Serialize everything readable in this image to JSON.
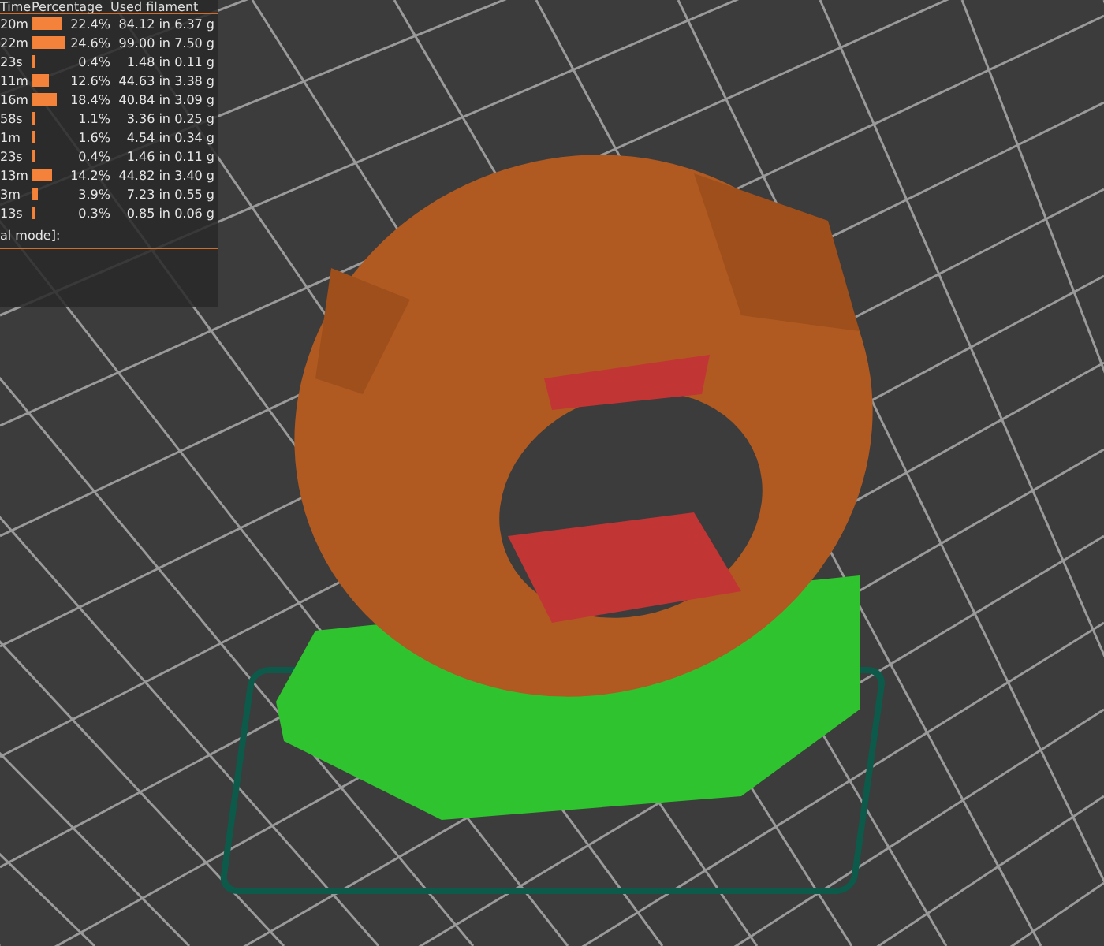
{
  "legend": {
    "headers": [
      "Time",
      "Percentage",
      "Used filament"
    ],
    "rows": [
      {
        "time": "20m",
        "level": 0.91,
        "percentage": "22.4%",
        "length": "84.12 in",
        "weight": "6.37 g"
      },
      {
        "time": "22m",
        "level": 1.0,
        "percentage": "24.6%",
        "length": "99.00 in",
        "weight": "7.50 g"
      },
      {
        "time": "23s",
        "level": 0.02,
        "percentage": "0.4%",
        "length": "1.48 in",
        "weight": "0.11 g"
      },
      {
        "time": "11m",
        "level": 0.51,
        "percentage": "12.6%",
        "length": "44.63 in",
        "weight": "3.38 g"
      },
      {
        "time": "16m",
        "level": 0.75,
        "percentage": "18.4%",
        "length": "40.84 in",
        "weight": "3.09 g"
      },
      {
        "time": "58s",
        "level": 0.04,
        "percentage": "1.1%",
        "length": "3.36 in",
        "weight": "0.25 g"
      },
      {
        "time": "1m",
        "level": 0.07,
        "percentage": "1.6%",
        "length": "4.54 in",
        "weight": "0.34 g"
      },
      {
        "time": "23s",
        "level": 0.02,
        "percentage": "0.4%",
        "length": "1.46 in",
        "weight": "0.11 g"
      },
      {
        "time": "13m",
        "level": 0.58,
        "percentage": "14.2%",
        "length": "44.82 in",
        "weight": "3.40 g"
      },
      {
        "time": "3m",
        "level": 0.16,
        "percentage": "3.9%",
        "length": "7.23 in",
        "weight": "0.55 g"
      },
      {
        "time": "13s",
        "level": 0.01,
        "percentage": "0.3%",
        "length": "0.85 in",
        "weight": "0.06 g"
      }
    ],
    "footer": "al mode]:"
  }
}
